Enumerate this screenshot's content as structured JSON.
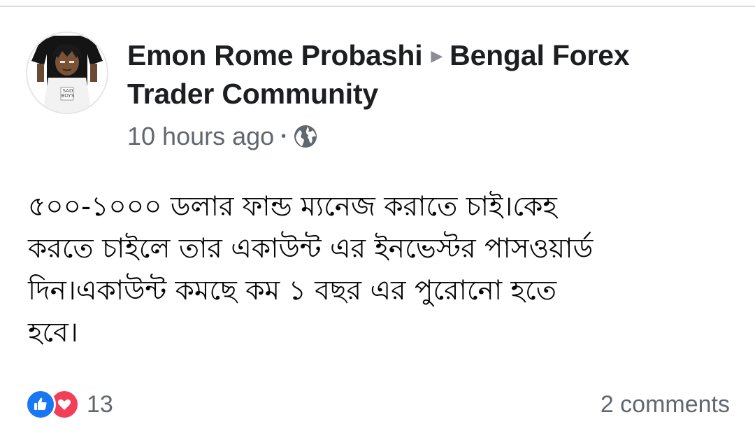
{
  "post": {
    "author": "Emon Rome Probashi",
    "group": "Bengal Forex",
    "group_line2": "Trader Community",
    "timestamp": "10 hours ago",
    "separator": "•",
    "privacy_icon": "globe-icon",
    "avatar_shirt_text": "SAD BOYS",
    "body": "৫০০-১০০০ ডলার ফান্ড ম্যনেজ করাতে চাই।কেহ\nকরতে চাইলে তার একাউন্ট এর ইনভেস্টর পাসওয়ার্ড\nদিন।একাউন্ট কমছে কম ১ বছর এর পুরোনো হতে\nহবে।",
    "reactions": {
      "icons": [
        "like-icon",
        "love-icon"
      ],
      "count": "13"
    },
    "comments": "2 comments"
  },
  "colors": {
    "like": "#1877f2",
    "love": "#f33e58",
    "meta_text": "#606770"
  }
}
